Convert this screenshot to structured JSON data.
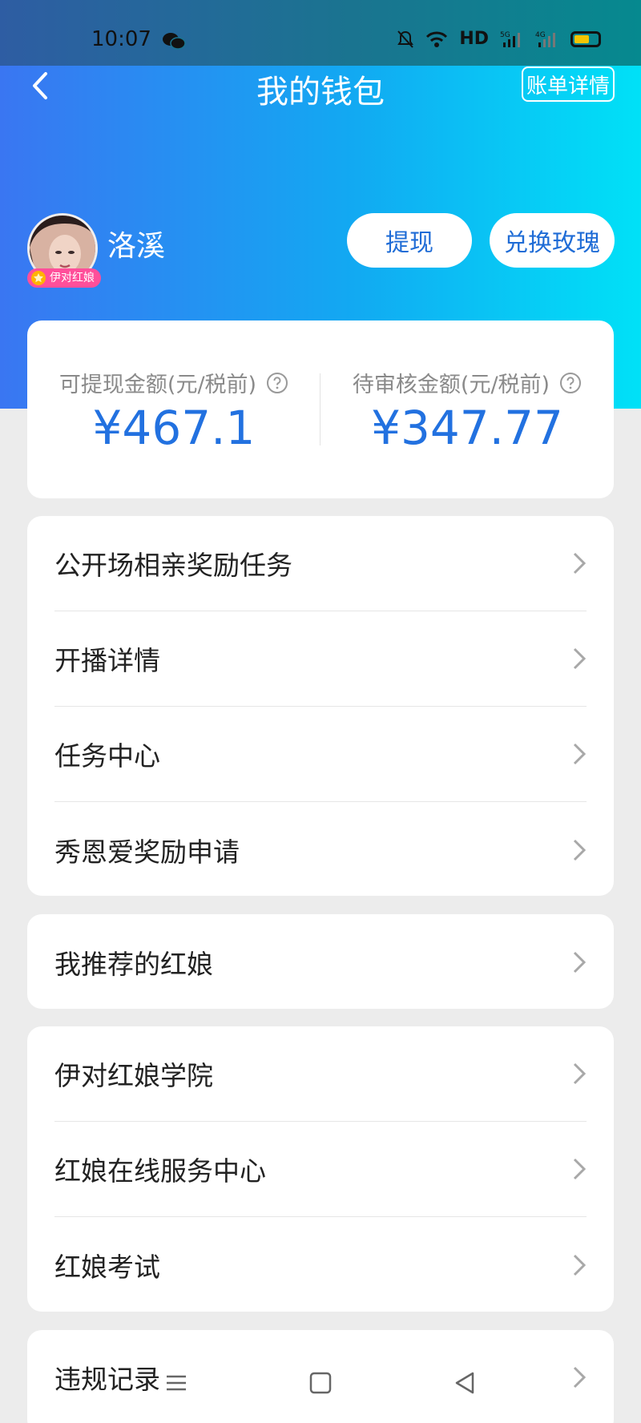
{
  "status_bar": {
    "time": "10:07",
    "network": "HD",
    "battery_color": "#f5c400"
  },
  "header": {
    "title": "我的钱包",
    "bill_button": "账单详情"
  },
  "profile": {
    "name": "洛溪",
    "badge": "伊对红娘",
    "withdraw_button": "提现",
    "exchange_button": "兑换玫瑰"
  },
  "balance": {
    "withdrawable_label": "可提现金额(元/税前)",
    "withdrawable_value": "¥467.1",
    "pending_label": "待审核金额(元/税前)",
    "pending_value": "¥347.77"
  },
  "menu_groups": [
    {
      "items": [
        {
          "label": "公开场相亲奖励任务"
        },
        {
          "label": "开播详情"
        },
        {
          "label": "任务中心"
        },
        {
          "label": "秀恩爱奖励申请"
        }
      ]
    },
    {
      "items": [
        {
          "label": "我推荐的红娘"
        }
      ]
    },
    {
      "items": [
        {
          "label": "伊对红娘学院"
        },
        {
          "label": "红娘在线服务中心"
        },
        {
          "label": "红娘考试"
        }
      ]
    },
    {
      "items": [
        {
          "label": "违规记录"
        }
      ]
    }
  ],
  "colors": {
    "accent": "#2271e0",
    "gradient_start": "#3a76f2",
    "gradient_end": "#00e1f7",
    "badge": "#ff4f9a"
  },
  "icons": [
    "back-arrow-icon",
    "help-icon",
    "chevron-right-icon",
    "wechat-icon",
    "star-icon",
    "menu-nav-icon",
    "home-nav-icon",
    "back-nav-icon"
  ]
}
